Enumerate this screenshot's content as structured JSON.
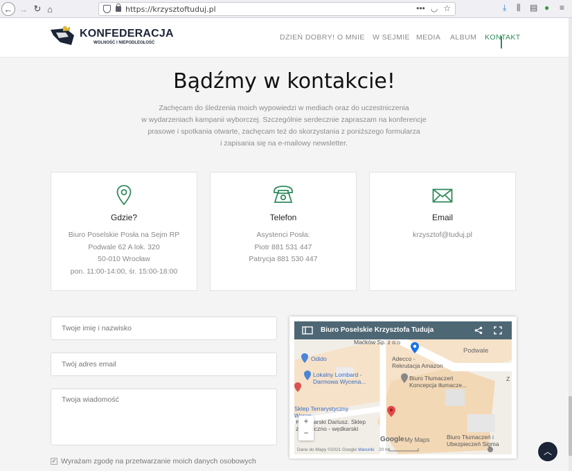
{
  "browser": {
    "url": "https://krzysztoftuduj.pl",
    "more_label": "•••"
  },
  "header": {
    "logo_name": "KONFEDERACJA",
    "logo_tagline": "WOLNOŚĆ I NIEPODLEGŁOŚĆ",
    "menu": [
      {
        "label": "DZIEŃ DOBRY!"
      },
      {
        "label": "O MNIE"
      },
      {
        "label": "W SEJMIE"
      },
      {
        "label": "MEDIA"
      },
      {
        "label": "ALBUM"
      },
      {
        "label": "KONTAKT",
        "active": true
      }
    ],
    "accent_color": "#2f8a5c"
  },
  "main": {
    "title": "Bądźmy w kontakcie!",
    "intro": [
      "Zachęcam do śledzenia moich wypowiedzi w mediach oraz do uczestniczenia",
      "w wydarzeniach kampanii wyborczej. Szczególnie serdecznie zapraszam na konferencje",
      "prasowe i spotkania otwarte, zachęcam też do skorzystania z poniższego formularza",
      "i zapisania się na e-mailowy newsletter."
    ],
    "cards": [
      {
        "icon": "map-pin-icon",
        "title": "Gdzie?",
        "lines": [
          "Biuro Poselskie Posła na Sejm RP",
          "Podwale 62 A lok. 320",
          "50-010 Wrocław",
          "pon. 11:00-14:00, śr. 15:00-18:00"
        ]
      },
      {
        "icon": "telephone-icon",
        "title": "Telefon",
        "lines": [
          "Asystenci Posła:",
          "Piotr 881 531 447",
          "Patrycja 881 530 447"
        ]
      },
      {
        "icon": "envelope-icon",
        "title": "Email",
        "lines": [
          "krzysztof@tuduj.pl"
        ]
      }
    ]
  },
  "form": {
    "name_placeholder": "Twoje imię i nazwisko",
    "email_placeholder": "Twój adres email",
    "message_placeholder": "Twoja wiadomość",
    "consent_label": "Wyrażam zgodę na przetwarzanie moich danych osobowych"
  },
  "map": {
    "title": "Biuro Poselskie Krzysztofa Tuduja",
    "labels": {
      "mackow": "Maćków Sp. z o.o",
      "adecco_1": "Adecco -",
      "adecco_2": "Rekrutacja Amazon",
      "podwale": "Podwale",
      "odido": "Odido",
      "lombard_1": "Lokalny Lombard -",
      "lombard_2": "Darmowa Wycena...",
      "tlum1_1": "Biuro Tłumaczeń",
      "tlum1_2": "Koncepcja tłumacze...",
      "terrarystyczny_1": "Sklep Terrarystyczny",
      "terrarystyczny_2": "Waran",
      "wedkarski_1": "Kaczmarski Dariusz. Sklep",
      "wedkarski_2": "zoologiczno - wędkarski",
      "tlum2_1": "Biuro Tłumaczeń i",
      "tlum2_2": "Ubezpieczeń Sigma",
      "google": "Google",
      "mymaps": "My Maps",
      "attribution": "Dane do Mapy ©2021 Google",
      "terms": "Warunki",
      "scale": "20 m",
      "zoom_in": "+",
      "zoom_out": "−",
      "edge_z": "Z"
    }
  },
  "ui": {
    "scroll_top_label": "︿"
  }
}
